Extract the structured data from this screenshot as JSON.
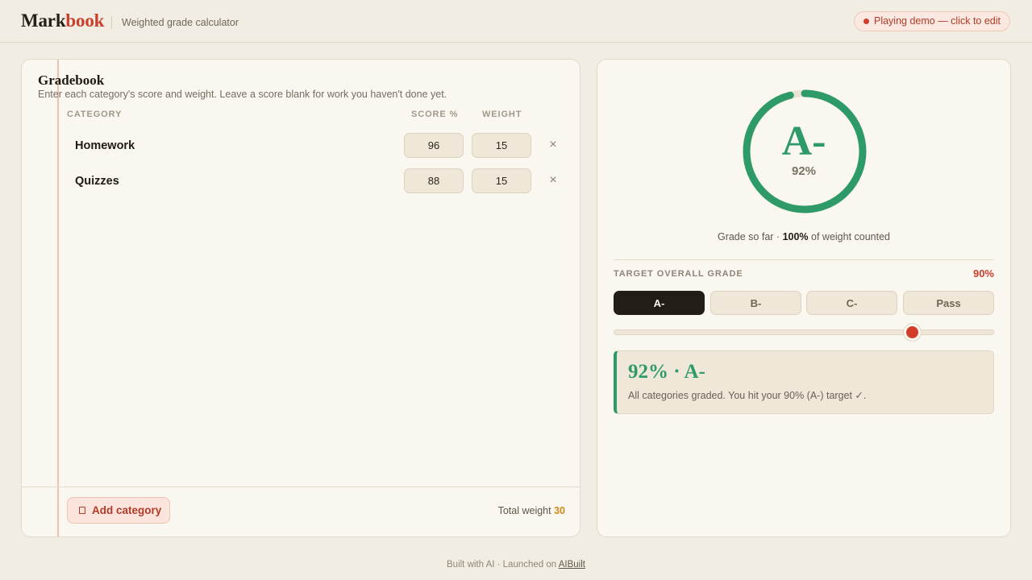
{
  "header": {
    "logo_part1": "Mark",
    "logo_part2": "book",
    "subtitle": "Weighted grade calculator",
    "demo_label": "Playing demo — click to edit"
  },
  "gradebook": {
    "title": "Gradebook",
    "description": "Enter each category's score and weight. Leave a score blank for work you haven't done yet.",
    "columns": {
      "category": "CATEGORY",
      "score": "SCORE %",
      "weight": "WEIGHT"
    },
    "rows": [
      {
        "name": "Homework",
        "score": "96",
        "weight": "15"
      },
      {
        "name": "Quizzes",
        "score": "88",
        "weight": "15"
      }
    ],
    "remove_symbol": "×",
    "add_label": "Add category",
    "total_weight_label": "Total weight",
    "total_weight_value": "30"
  },
  "summary": {
    "letter_grade": "A-",
    "percent": "92%",
    "progress_fraction": 0.96,
    "so_far_prefix": "Grade so far · ",
    "so_far_value": "100%",
    "so_far_suffix": " of weight counted",
    "target_label": "TARGET OVERALL GRADE",
    "target_value": "90%",
    "presets": [
      "A-",
      "B-",
      "C-",
      "Pass"
    ],
    "active_preset": 0,
    "slider_fraction": 0.9,
    "result_headline": "92% · A-",
    "result_text": "All categories graded. You hit your 90% (A-) target ✓."
  },
  "footer": {
    "text": "Built with AI · Launched on ",
    "link": "AIBuilt"
  },
  "colors": {
    "accent_red": "#c9402c",
    "success_green": "#2e9a68",
    "ring_track": "#ece4d3",
    "weight_orange": "#d08a1a"
  }
}
